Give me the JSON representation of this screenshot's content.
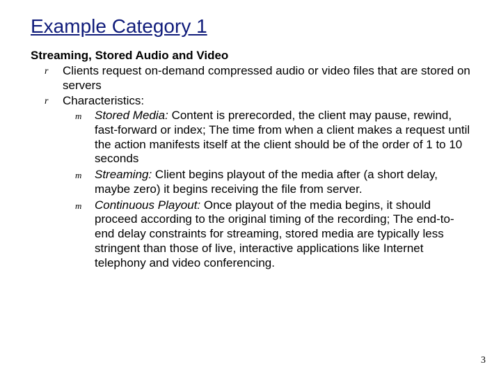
{
  "title": "Example Category 1",
  "section_head": "Streaming, Stored Audio and Video",
  "bullets": [
    {
      "text": "Clients request on-demand compressed audio or video files that are stored on servers"
    },
    {
      "text": "Characteristics:",
      "sub": [
        {
          "lead": "Stored Media:",
          "text": " Content is prerecorded, the client may pause, rewind, fast-forward or index; The time from when a client makes a request until the action manifests itself at the client should be of the order of 1 to 10 seconds"
        },
        {
          "lead": "Streaming:",
          "text": " Client begins playout of the media after (a short delay, maybe zero) it begins receiving the file from server."
        },
        {
          "lead": "Continuous Playout:",
          "text": " Once playout of the media begins, it should proceed according to the original timing of the recording; The end-to-end delay constraints for streaming, stored media are typically less stringent than those of live, interactive applications like Internet telephony and video conferencing."
        }
      ]
    }
  ],
  "page_number": "3",
  "glyphs": {
    "r": "r",
    "m": "m"
  }
}
